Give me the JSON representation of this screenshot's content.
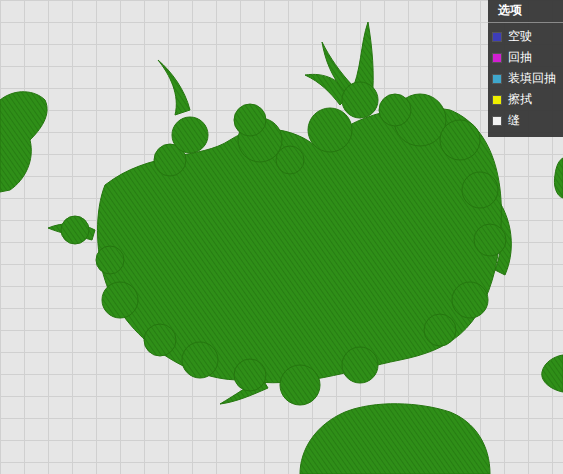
{
  "legend": {
    "title": "选项",
    "items": [
      {
        "label": "空驶",
        "color": "#3d3db8"
      },
      {
        "label": "回抽",
        "color": "#d21fd2"
      },
      {
        "label": "装填回抽",
        "color": "#3fa7cc"
      },
      {
        "label": "擦拭",
        "color": "#eeee00"
      },
      {
        "label": "缝",
        "color": "#f2f2f2"
      }
    ]
  }
}
